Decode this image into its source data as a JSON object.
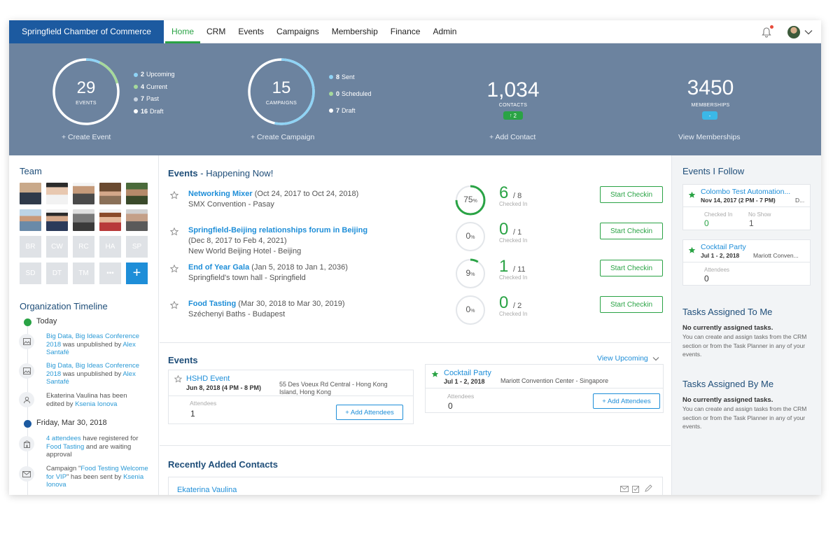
{
  "nav": {
    "brand": "Springfield Chamber of Commerce",
    "items": [
      "Home",
      "CRM",
      "Events",
      "Campaigns",
      "Membership",
      "Finance",
      "Admin"
    ],
    "active": "Home"
  },
  "stats": {
    "events": {
      "count": "29",
      "label": "EVENTS",
      "link": "+ Create Event",
      "legend": [
        {
          "num": "2",
          "text": "Upcoming",
          "color": "#8fd3f5"
        },
        {
          "num": "4",
          "text": "Current",
          "color": "#a5d99b"
        },
        {
          "num": "7",
          "text": "Past",
          "color": "#c8d3e0"
        },
        {
          "num": "16",
          "text": "Draft",
          "color": "#ffffff"
        }
      ]
    },
    "campaigns": {
      "count": "15",
      "label": "CAMPAIGNS",
      "link": "+ Create Campaign",
      "legend": [
        {
          "num": "8",
          "text": "Sent",
          "color": "#8fd3f5"
        },
        {
          "num": "0",
          "text": "Scheduled",
          "color": "#a5d99b"
        },
        {
          "num": "7",
          "text": "Draft",
          "color": "#ffffff"
        }
      ]
    },
    "contacts": {
      "count": "1,034",
      "label": "CONTACTS",
      "badge": "2",
      "link": "+ Add Contact"
    },
    "memberships": {
      "count": "3450",
      "label": "MEMBERSHIPS",
      "badge": "-",
      "link": "View Memberships"
    }
  },
  "team": {
    "title": "Team",
    "initials": [
      "BR",
      "CW",
      "RC",
      "HA",
      "SP",
      "SD",
      "DT",
      "TM"
    ],
    "more": "•••",
    "add": "+"
  },
  "timeline": {
    "title": "Organization Timeline",
    "today": "Today",
    "items": [
      {
        "link": "Big Data, Big Ideas Conference 2018",
        "text": " was unpublished by ",
        "user": "Alex Santafé"
      },
      {
        "link": "Big Data, Big Ideas Conference 2018",
        "text": " was unpublished by ",
        "user": "Alex Santafé"
      },
      {
        "name": "Ekaterina Vaulina",
        "text": " has been edited by ",
        "user": "Ksenia Ionova"
      }
    ],
    "date2": "Friday, Mar 30, 2018",
    "items2": [
      {
        "link": "4 attendees",
        "text": " have registered for ",
        "event": "Food Tasting",
        "text2": " and are waiting approval"
      },
      {
        "pre": "Campaign \"",
        "link": "Food Testing Welcome for VIP",
        "text": "\" has been sent by ",
        "user": "Ksenia Ionova"
      }
    ]
  },
  "happening": {
    "title": "Events",
    "subtitle": " - Happening Now!",
    "events": [
      {
        "name": "Networking Mixer",
        "dates": " (Oct 24, 2017 to Oct 24, 2018)",
        "location": "SMX Convention - Pasay",
        "percent": 75,
        "percent_label": "75",
        "checked": "6",
        "total": "/ 8",
        "checked_label": "Checked In",
        "button": "Start Checkin"
      },
      {
        "name": "Springfield-Beijing relationships forum in Beijing",
        "dates": "(Dec 8, 2017 to Feb 4, 2021)",
        "location": "New World Beijing Hotel - Beijing",
        "percent": 0,
        "percent_label": "0",
        "checked": "0",
        "total": "/ 1",
        "checked_label": "Checked In",
        "button": "Start Checkin"
      },
      {
        "name": "End of Year Gala",
        "dates": " (Jan 5, 2018 to Jan 1, 2036)",
        "location": "Springfield's town hall - Springfield",
        "percent": 9,
        "percent_label": "9",
        "checked": "1",
        "total": "/ 11",
        "checked_label": "Checked In",
        "button": "Start Checkin"
      },
      {
        "name": "Food Tasting",
        "dates": " (Mar 30, 2018 to Mar 30, 2019)",
        "location": "Széchenyi Baths - Budapest",
        "percent": 0,
        "percent_label": "0",
        "checked": "0",
        "total": "/ 2",
        "checked_label": "Checked In",
        "button": "Start Checkin"
      }
    ]
  },
  "events_section": {
    "title": "Events",
    "view_link": "View Upcoming",
    "cards": [
      {
        "name": "HSHD Event",
        "date": "Jun 8, 2018 (4 PM - 8 PM)",
        "location": "55 Des Voeux Rd Central - Hong Kong Island, Hong Kong",
        "attendees_label": "Attendees",
        "attendees": "1",
        "button": "+ Add Attendees",
        "starred": false
      },
      {
        "name": "Cocktail Party",
        "date": "Jul 1 - 2, 2018",
        "location": "Mariott Convention Center - Singapore",
        "attendees_label": "Attendees",
        "attendees": "0",
        "button": "+ Add Attendees",
        "starred": true
      }
    ]
  },
  "contacts_section": {
    "title": "Recently Added Contacts",
    "first": "Ekaterina Vaulina"
  },
  "follow": {
    "title": "Events I Follow",
    "cards": [
      {
        "name": "Colombo Test Automation...",
        "date": "Nov 14, 2017 (2 PM - 7 PM)",
        "extra": "D...",
        "lbl1": "Checked In",
        "val1": "0",
        "lbl2": "No Show",
        "val2": "1"
      },
      {
        "name": "Cocktail Party",
        "date": "Jul 1 - 2, 2018",
        "extra": "Mariott Conven...",
        "lbl1": "Attendees",
        "val1": "0"
      }
    ]
  },
  "tasks_to_me": {
    "title": "Tasks Assigned To Me",
    "bold": "No currently assigned tasks.",
    "text": "You can create and assign tasks from the CRM section or from the Task Planner in any of your events."
  },
  "tasks_by_me": {
    "title": "Tasks Assigned By Me",
    "bold": "No currently assigned tasks.",
    "text": "You can create and assign tasks from the CRM section or from the Task Planner in any of your events."
  },
  "colors": {
    "brand": "#1c5aa0",
    "accent_green": "#2aa345",
    "link_blue": "#1e8ed8",
    "stats_bg": "#6c839f"
  }
}
